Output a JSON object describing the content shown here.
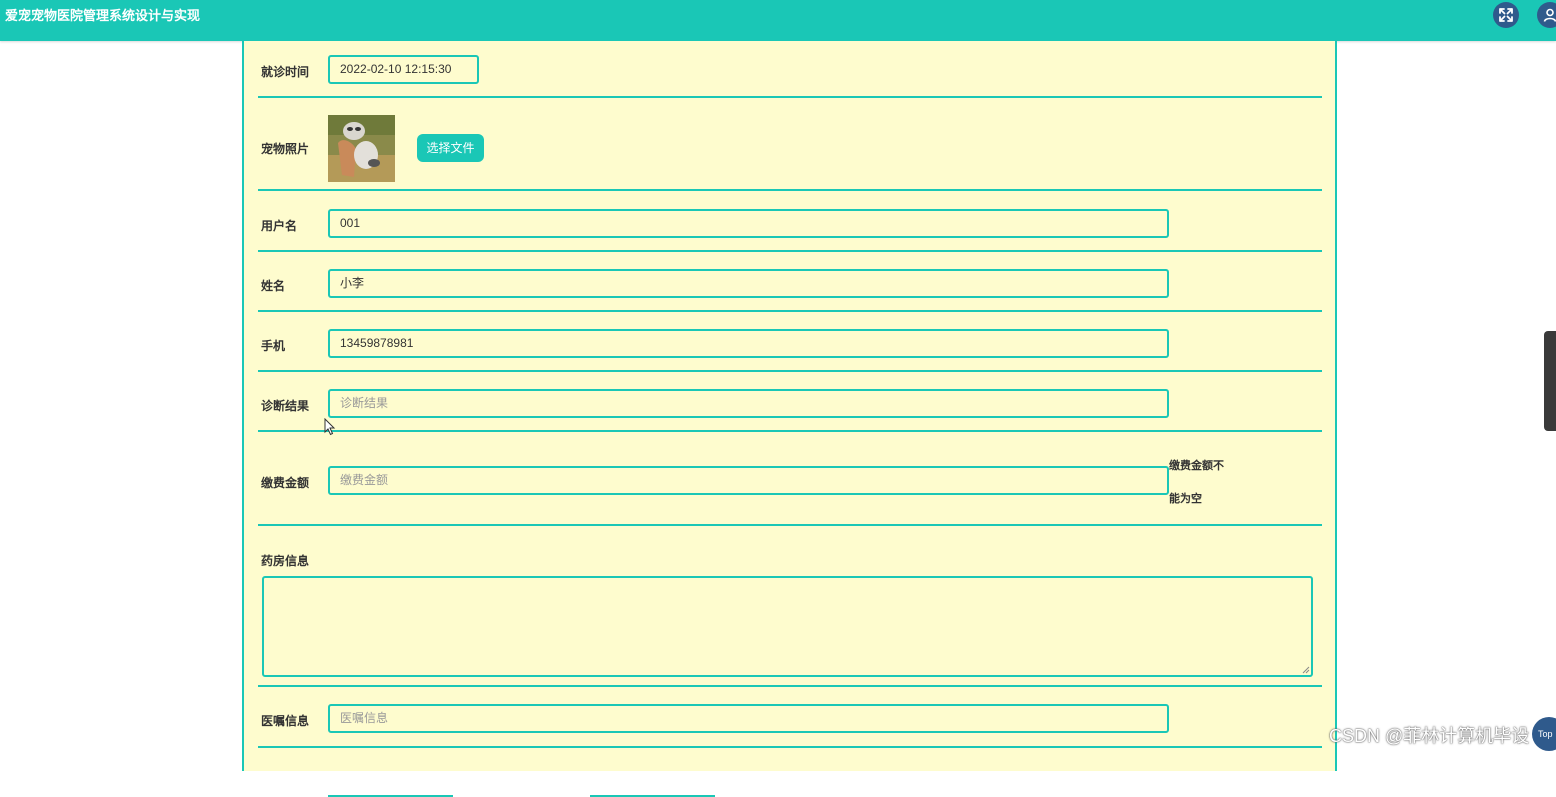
{
  "app": {
    "title": "爱宠宠物医院管理系统设计与实现"
  },
  "form": {
    "visit_time": {
      "label": "就诊时间",
      "value": "2022-02-10 12:15:30"
    },
    "pet_photo": {
      "label": "宠物照片",
      "button_label": "选择文件"
    },
    "username": {
      "label": "用户名",
      "value": "001"
    },
    "name": {
      "label": "姓名",
      "value": "小李"
    },
    "phone": {
      "label": "手机",
      "value": "13459878981"
    },
    "diagnosis": {
      "label": "诊断结果",
      "placeholder": "诊断结果"
    },
    "payment": {
      "label": "缴费金额",
      "placeholder": "缴费金额",
      "error_line1": "缴费金额不",
      "error_line2": "能为空"
    },
    "pharmacy": {
      "label": "药房信息"
    },
    "advice": {
      "label": "医嘱信息",
      "placeholder": "医嘱信息"
    }
  },
  "watermark": "CSDN @菲林计算机毕设",
  "back_to_top": "Top",
  "colors": {
    "accent": "#1ac7b6",
    "panel_bg": "#fefcce",
    "icon_bg": "#2f5a8c"
  },
  "icons": [
    "fullscreen-icon",
    "user-icon",
    "cursor-icon"
  ]
}
